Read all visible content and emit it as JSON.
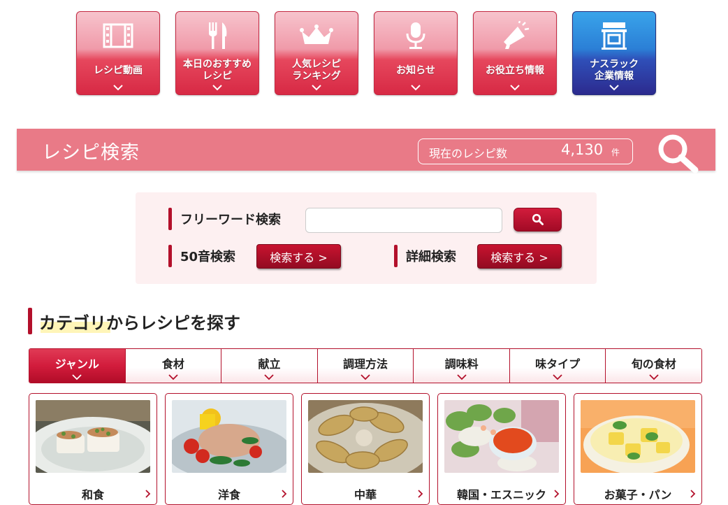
{
  "nav": [
    {
      "label": "レシピ動画",
      "icon": "film-icon",
      "theme": "red"
    },
    {
      "label": "本日のおすすめ\nレシピ",
      "icon": "fork-knife-icon",
      "theme": "red"
    },
    {
      "label": "人気レシピ\nランキング",
      "icon": "crown-icon",
      "theme": "red"
    },
    {
      "label": "お知らせ",
      "icon": "microphone-icon",
      "theme": "red"
    },
    {
      "label": "お役立ち情報",
      "icon": "megaphone-icon",
      "theme": "red"
    },
    {
      "label": "ナスラック\n企業情報",
      "icon": "building-icon",
      "theme": "blue"
    }
  ],
  "band": {
    "title": "レシピ検索",
    "count_label": "現在のレシピ数",
    "count_value": "4,130",
    "count_unit": "件"
  },
  "search": {
    "freeword_label": "フリーワード検索",
    "freeword_value": "",
    "kana_label": "50音検索",
    "kana_button": "検索する >",
    "detail_label": "詳細検索",
    "detail_button": "検索する >"
  },
  "category": {
    "title": "カテゴリからレシピを探す",
    "tabs": [
      "ジャンル",
      "食材",
      "献立",
      "調理方法",
      "調味料",
      "味タイプ",
      "旬の食材"
    ],
    "active_tab": "ジャンル",
    "cards": [
      "和食",
      "洋食",
      "中華",
      "韓国・エスニック",
      "お菓子・パン"
    ]
  },
  "colors": {
    "accent_red": "#b3102b",
    "band_pink": "#e97a87",
    "search_bg": "#fdf0f1",
    "nav_blue": "#2f4fb8"
  }
}
